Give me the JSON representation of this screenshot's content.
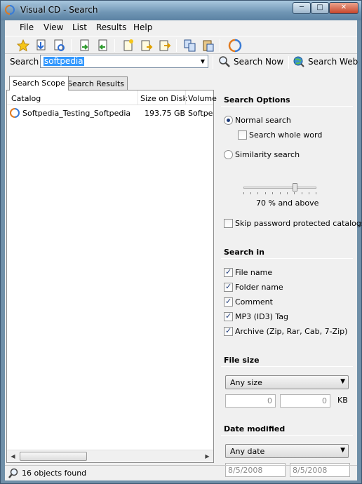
{
  "window": {
    "title": "Visual CD - Search"
  },
  "menu": [
    "File",
    "View",
    "List",
    "Results",
    "Help"
  ],
  "toolbar": {
    "icons": [
      "star-icon",
      "down-arrow-doc-icon",
      "refresh-doc-icon",
      "doc-green-arrow-icon",
      "doc-red-arrow-icon",
      "new-doc-icon",
      "doc-add-icon",
      "doc-export-icon",
      "copy-icon",
      "paste-icon",
      "visual-cd-icon"
    ]
  },
  "search": {
    "label": "Search",
    "value": "softpedia",
    "search_now": "Search Now",
    "search_web": "Search Web"
  },
  "tabs": [
    "Search Scope",
    "Search Results"
  ],
  "list": {
    "columns": [
      "Catalog",
      "Size on Disk",
      "Volume"
    ],
    "rows": [
      {
        "catalog": "Softpedia_Testing_Softpedia",
        "size": "193.75 GB",
        "volume": "Softpedia"
      }
    ]
  },
  "options": {
    "title": "Search Options",
    "normal": "Normal search",
    "whole_word": "Search whole word",
    "similarity": "Similarity search",
    "similarity_pct": "70 % and above",
    "similarity_level": 0.7,
    "skip_password": "Skip password protected catalogs",
    "normal_selected": true,
    "whole_word_checked": false,
    "skip_password_checked": false
  },
  "search_in": {
    "title": "Search in",
    "items": [
      {
        "label": "File name",
        "checked": true
      },
      {
        "label": "Folder name",
        "checked": true
      },
      {
        "label": "Comment",
        "checked": true
      },
      {
        "label": "MP3 (ID3) Tag",
        "checked": true
      },
      {
        "label": "Archive (Zip, Rar, Cab, 7-Zip)",
        "checked": true
      }
    ]
  },
  "file_size": {
    "title": "File size",
    "mode": "Any size",
    "min": "0",
    "max": "0",
    "unit": "KB"
  },
  "date_modified": {
    "title": "Date modified",
    "mode": "Any date",
    "from": "8/5/2008",
    "to": "8/5/2008"
  },
  "status": {
    "text": "16 objects found"
  },
  "colors": {
    "accent": "#3399ff",
    "title_bar": "#6f95b4"
  }
}
